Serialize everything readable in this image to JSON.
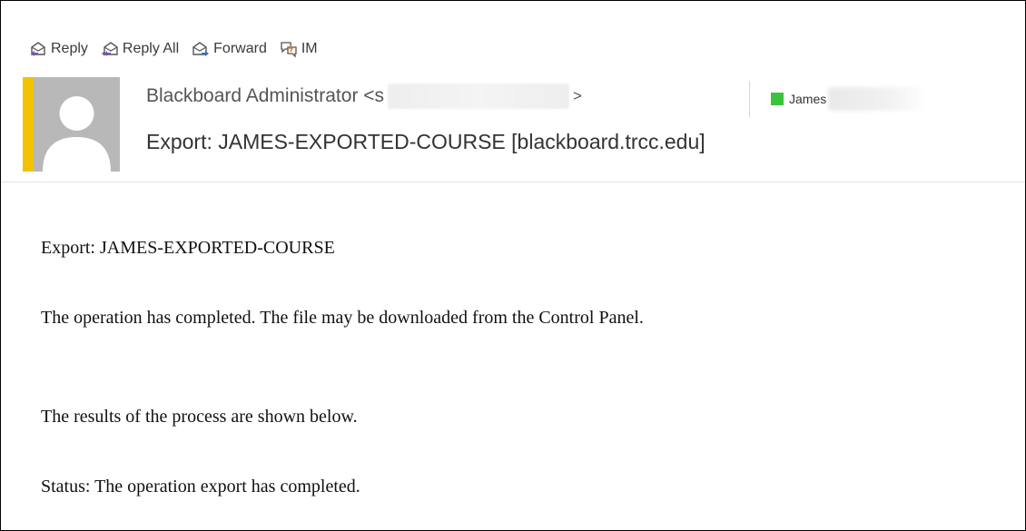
{
  "toolbar": {
    "reply": "Reply",
    "reply_all": "Reply All",
    "forward": "Forward",
    "im": "IM"
  },
  "header": {
    "sender_name": "Blackboard Administrator <s",
    "sender_end": ">",
    "recipient_name": "James",
    "subject": "Export: JAMES-EXPORTED-COURSE [blackboard.trcc.edu]"
  },
  "body": {
    "line1": "Export: JAMES-EXPORTED-COURSE",
    "line2": "The operation has completed. The file may be downloaded from the Control Panel.",
    "line3": "The results of the process are shown below.",
    "line4": "Status: The operation export has completed."
  },
  "colors": {
    "accent": "#f2c200",
    "presence": "#3cc33c",
    "icon_purple": "#7a4fb8",
    "icon_orange": "#e07b2a",
    "icon_blue": "#2f6fd0"
  }
}
